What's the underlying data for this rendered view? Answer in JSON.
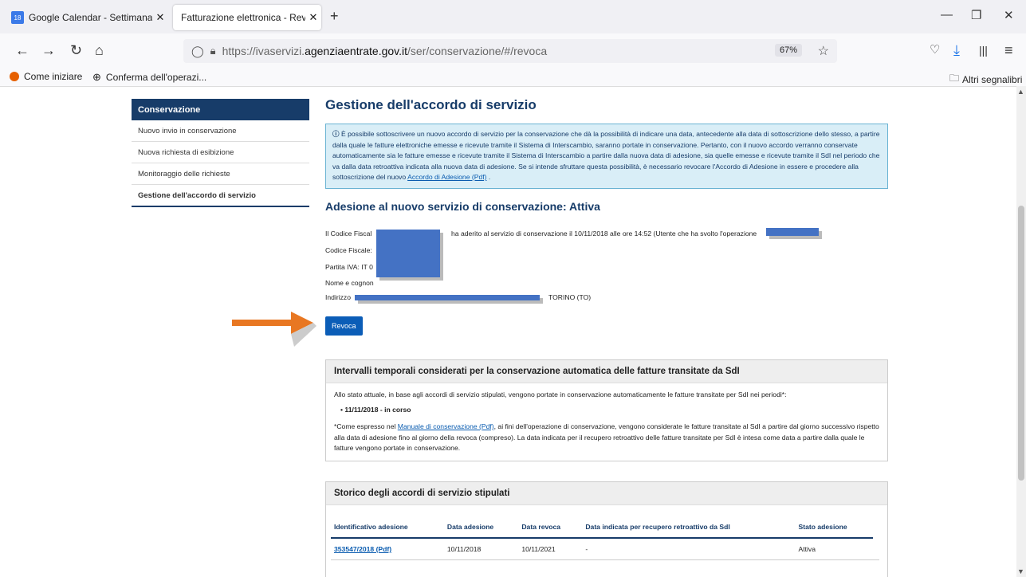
{
  "browser": {
    "tabs": [
      {
        "label": "Google Calendar - Settimana de",
        "icon": "calendar-icon"
      },
      {
        "label": "Fatturazione elettronica - Revoca",
        "icon": ""
      }
    ],
    "url_prefix": "https://ivaservizi.",
    "url_domain": "agenziaentrate.gov.it",
    "url_path": "/ser/conservazione/#/revoca",
    "zoom": "67%",
    "bookmarks": [
      {
        "label": "Come iniziare"
      },
      {
        "label": "Conferma dell'operazi..."
      }
    ],
    "other_bookmarks": "Altri segnalibri"
  },
  "sidebar": {
    "header": "Conservazione",
    "items": [
      {
        "label": "Nuovo invio in conservazione"
      },
      {
        "label": "Nuova richiesta di esibizione"
      },
      {
        "label": "Monitoraggio delle richieste"
      },
      {
        "label": "Gestione dell'accordo di servizio"
      }
    ]
  },
  "main": {
    "title": "Gestione dell'accordo di servizio",
    "info_text": "È possibile sottoscrivere un nuovo accordo di servizio per la conservazione che dà la possibilità di indicare una data, antecedente alla data di sottoscrizione dello stesso, a partire dalla quale le fatture elettroniche emesse e ricevute tramite il Sistema di Interscambio, saranno portate in conservazione. Pertanto, con il nuovo accordo verranno conservate automaticamente sia le fatture emesse e ricevute tramite il Sistema di Interscambio a partire dalla nuova data di adesione, sia quelle emesse e ricevute tramite il SdI nel periodo che va dalla data retroattiva indicata alla nuova data di adesione. Se si intende sfruttare questa possibilità, è necessario revocare l'Accordo di Adesione in essere e procedere alla sottoscrizione del nuovo",
    "info_link": "Accordo di Adesione (Pdf)",
    "subtitle": "Adesione al nuovo servizio di conservazione: Attiva",
    "line1_a": "Il Codice Fiscal",
    "line1_b": "ha aderito al servizio di conservazione il 10/11/2018 alle ore 14:52 (Utente che ha svolto l'operazione",
    "line2": "Codice Fiscale:",
    "line3": "Partita IVA: IT 0",
    "line4": "Nome e cognon",
    "line5_a": "Indirizzo",
    "line5_b": "TORINO (TO)",
    "revoke_button": "Revoca"
  },
  "panel1": {
    "title": "Intervalli temporali considerati per la conservazione automatica delle fatture transitate da SdI",
    "intro": "Allo stato attuale, in base agli accordi di servizio stipulati, vengono portate in conservazione automaticamente le fatture transitate per SdI nei periodi*:",
    "period": "11/11/2018 - in corso",
    "note_a": "*Come espresso nel",
    "note_link": "Manuale di conservazione (Pdf)",
    "note_b": ", ai fini dell'operazione di conservazione, vengono considerate le fatture transitate al SdI a partire dal giorno successivo rispetto alla data di adesione fino al giorno della revoca (compreso). La data indicata per il recupero retroattivo delle fatture transitate per SdI è intesa come data a partire dalla quale le fatture vengono portate in conservazione."
  },
  "panel2": {
    "title": "Storico degli accordi di servizio stipulati",
    "columns": [
      "Identificativo adesione",
      "Data adesione",
      "Data revoca",
      "Data indicata per recupero retroattivo da SdI",
      "Stato adesione"
    ],
    "rows": [
      [
        "353547/2018 (Pdf)",
        "10/11/2018",
        "10/11/2021",
        "-",
        "Attiva"
      ]
    ]
  }
}
